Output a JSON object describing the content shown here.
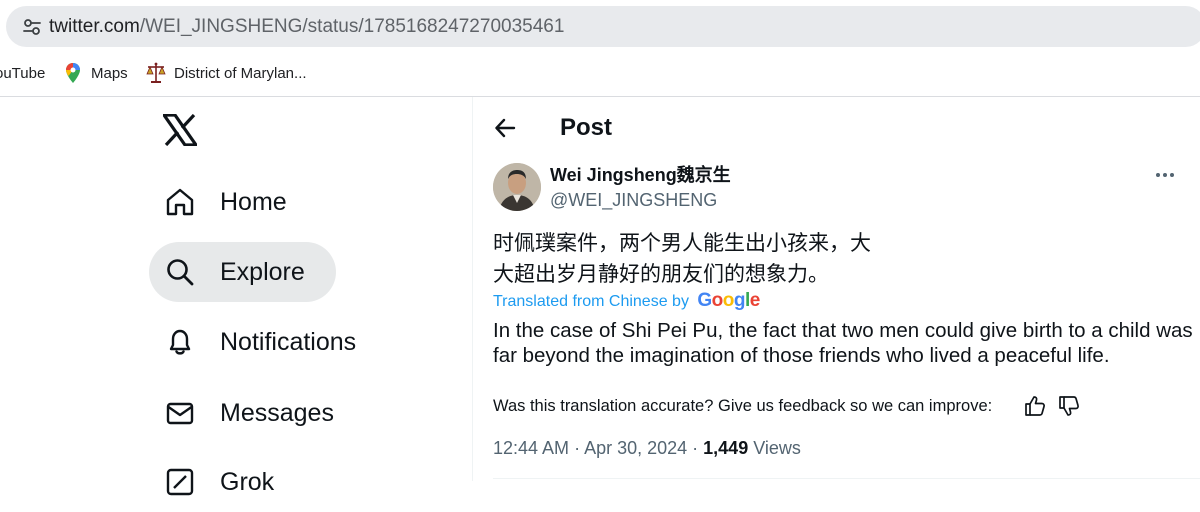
{
  "browser": {
    "url_host": "twitter.com",
    "url_path": "/WEI_JINGSHENG/status/1785168247270035461",
    "bookmarks": [
      {
        "label": "ouTube"
      },
      {
        "label": "Maps"
      },
      {
        "label": "District of Marylan..."
      }
    ]
  },
  "sidebar": {
    "items": [
      {
        "label": "Home",
        "icon": "home-icon"
      },
      {
        "label": "Explore",
        "icon": "search-icon",
        "active": true
      },
      {
        "label": "Notifications",
        "icon": "bell-icon"
      },
      {
        "label": "Messages",
        "icon": "envelope-icon"
      },
      {
        "label": "Grok",
        "icon": "grok-icon"
      }
    ]
  },
  "header": {
    "title": "Post"
  },
  "post": {
    "display_name": "Wei Jingsheng魏京生",
    "handle": "@WEI_JINGSHENG",
    "text": "时佩璞案件，两个男人能生出小孩来，大大超出岁月静好的朋友们的想象力。",
    "translated_label": "Translated from Chinese by",
    "translator": "Google",
    "translation": "In the case of Shi Pei Pu, the fact that two men could give birth to a child was far beyond the imagination of those friends who lived a peaceful life.",
    "feedback_prompt": "Was this translation accurate? Give us feedback so we can improve:",
    "time": "12:44 AM",
    "separator": " · ",
    "date": "Apr 30, 2024",
    "views_count": "1,449",
    "views_label": "Views"
  },
  "colors": {
    "accent": "#1d9bf0",
    "text_primary": "#0f1419",
    "text_secondary": "#536471",
    "nav_active_bg": "#e7e9ea",
    "address_bar_bg": "#e8eaed"
  }
}
